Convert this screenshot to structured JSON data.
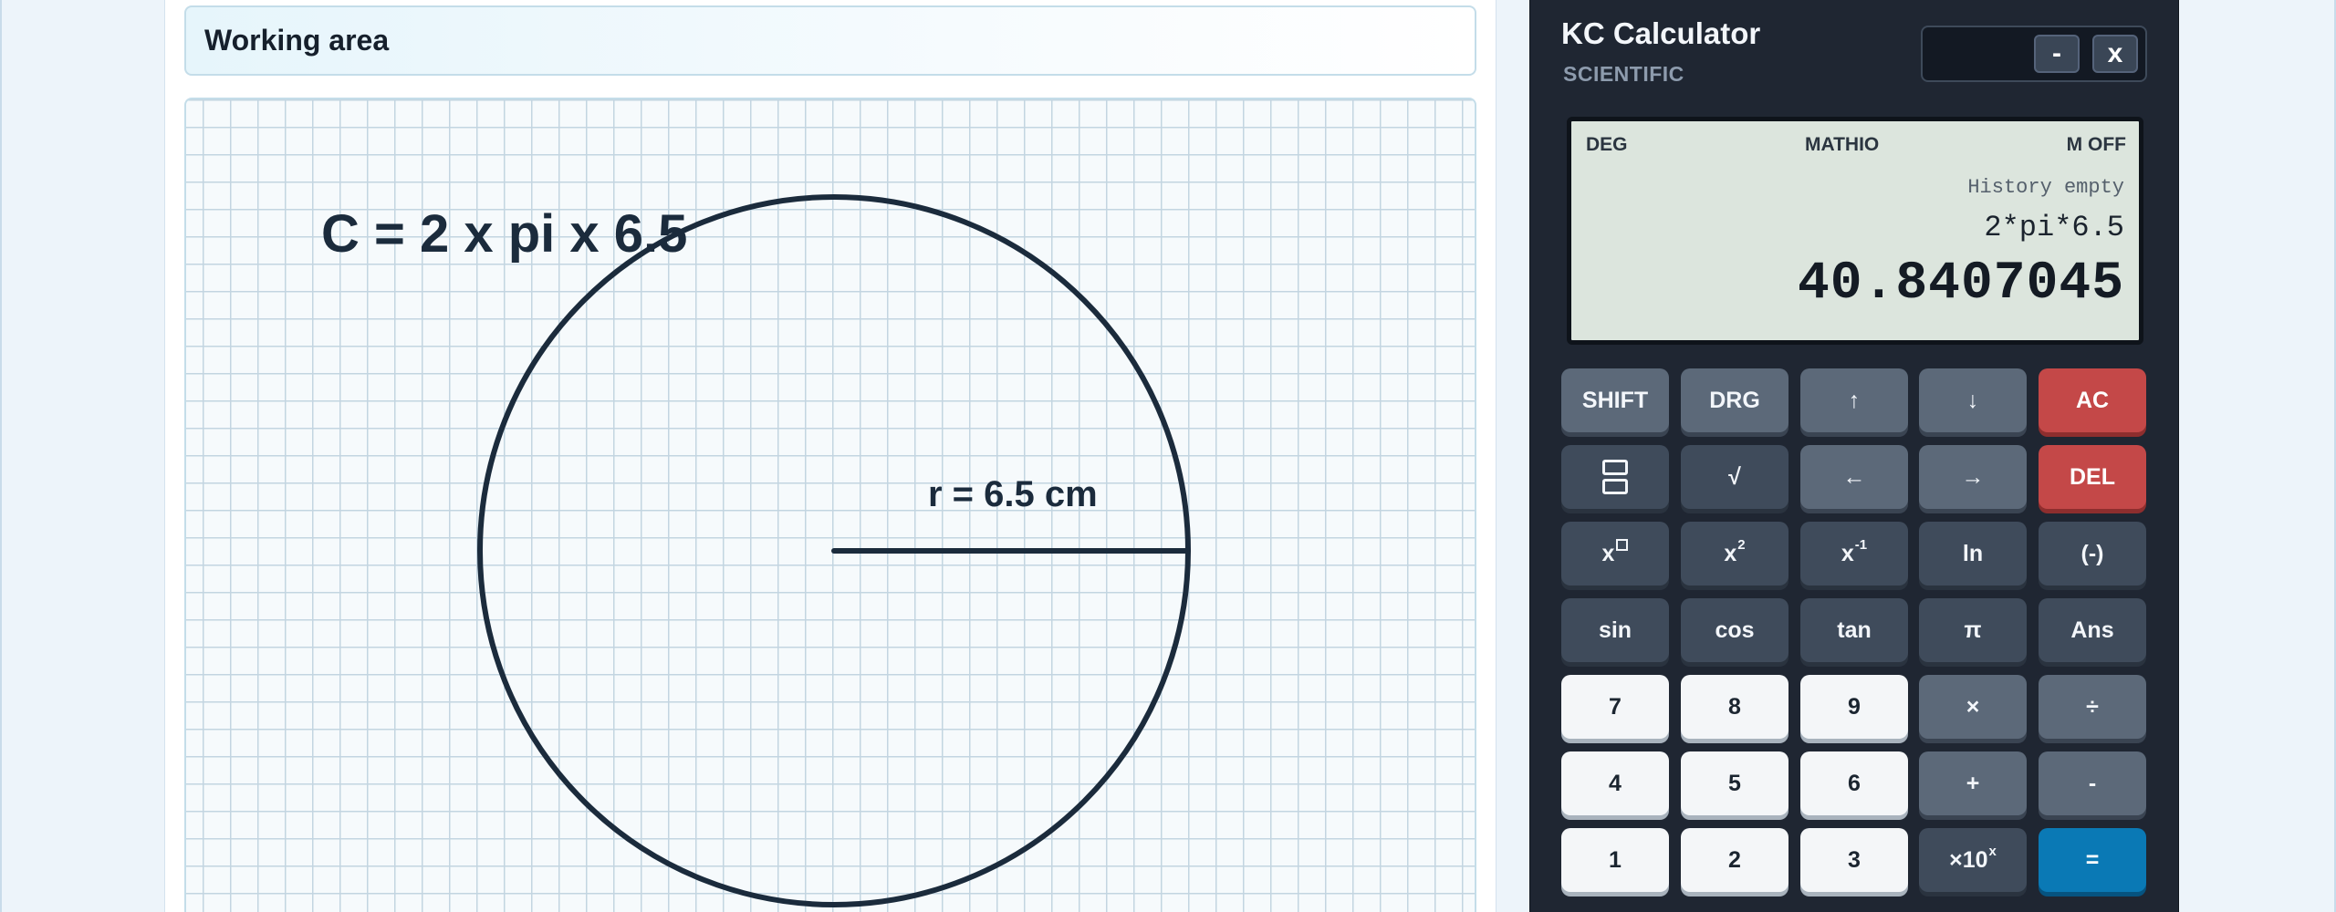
{
  "worksheet": {
    "title": "Working area",
    "formula_label": "C = 2 x pi x 6.5",
    "radius_label": "r = 6.5 cm"
  },
  "calculator": {
    "title": "KC Calculator",
    "subtitle": "SCIENTIFIC",
    "window": {
      "minimize_label": "-",
      "close_label": "x"
    },
    "display": {
      "angle_mode": "DEG",
      "input_mode": "MATHIO",
      "memory_status": "M OFF",
      "history": "History empty",
      "expression": "2*pi*6.5",
      "result": "40.8407045"
    },
    "keys": {
      "shift": "SHIFT",
      "drg": "DRG",
      "up": "↑",
      "down": "↓",
      "ac": "AC",
      "fraction_icon": "fraction-icon",
      "sqrt": "√",
      "left": "←",
      "right": "→",
      "del": "DEL",
      "power_base": "x",
      "square_base": "x",
      "square_exp": "2",
      "inverse_base": "x",
      "inverse_exp": "-1",
      "ln": "ln",
      "negate": "(-)",
      "sin": "sin",
      "cos": "cos",
      "tan": "tan",
      "pi": "π",
      "ans": "Ans",
      "seven": "7",
      "eight": "8",
      "nine": "9",
      "multiply": "×",
      "divide": "÷",
      "four": "4",
      "five": "5",
      "six": "6",
      "plus": "+",
      "minus": "-",
      "one": "1",
      "two": "2",
      "three": "3",
      "exp_base": "×10",
      "exp_exp": "x",
      "equals": "="
    },
    "colors": {
      "body": "#1f2632",
      "lcd": "#dce5dd",
      "red_keys": "#c44848",
      "equals_key": "#0a79b5"
    }
  }
}
